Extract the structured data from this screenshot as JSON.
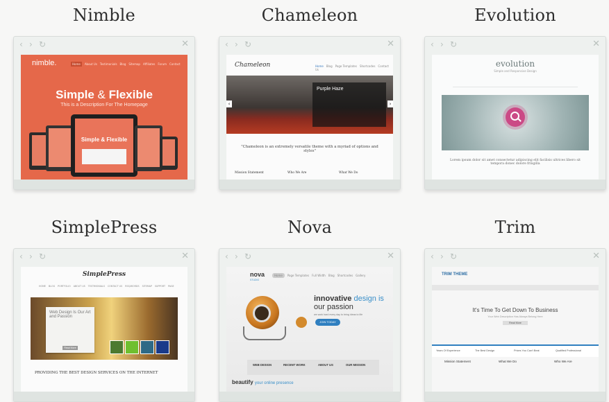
{
  "themes": [
    {
      "title": "Nimble",
      "brand": "nimble.",
      "nav": [
        "Home",
        "About Us",
        "Testimonials",
        "Blog",
        "Sitemap",
        "Affiliates",
        "Forum",
        "Contact"
      ],
      "headline_a": "Simple",
      "headline_amp": "&",
      "headline_b": "Flexible",
      "subline": "This is a Description For The Homepage",
      "inner_headline": "Simple & Flexible",
      "accent": "#e5684a"
    },
    {
      "title": "Chameleon",
      "brand": "Chameleon",
      "nav": [
        "Home",
        "Blog",
        "Page Templates",
        "Shortcodes",
        "Contact Us"
      ],
      "slide_title": "Purple Haze",
      "quote": "\"Chameleon is an extremely versatile theme with a myriad of options and styles\"",
      "columns": [
        "Mission Statement",
        "Who We Are",
        "What We Do"
      ]
    },
    {
      "title": "Evolution",
      "brand": "evolution",
      "tagline": "Simple and Responsive Design",
      "quote": "Lorem ipsum dolor sit amet consectetur adipiscing elit facilisis ultrices libero sit tempora donec dolore fringilla"
    },
    {
      "title": "SimplePress",
      "brand": "SimplePress",
      "nav": [
        "HOME",
        "BLOG",
        "PORTFOLIO",
        "ABOUT US",
        "TESTIMONIALS",
        "CONTACT US",
        "RSS/WORDS",
        "SITEMAP",
        "SUPPORT",
        "PAGE"
      ],
      "card_title": "Web Design Is Our Art and Passion",
      "card_button": "Read More",
      "banner": "PROVIDING THE BEST DESIGN SERVICES ON THE INTERNET"
    },
    {
      "title": "Nova",
      "brand": "nova",
      "brand_sub": "STUDIO",
      "nav": [
        "Home",
        "Page Templates",
        "Full Width",
        "Blog",
        "Shortcodes",
        "Gallery"
      ],
      "headline_a": "innovative",
      "headline_b": "design is",
      "headline_c": "our passion",
      "subline": "we work hard every day to bring ideas to life",
      "cta": "JOIN TODAY",
      "tabs": [
        "WEB DESIGN",
        "RECENT WORK",
        "ABOUT US",
        "OUR MISSION"
      ],
      "tagline_a": "beautify",
      "tagline_b": "your online presence"
    },
    {
      "title": "Trim",
      "brand": "TRIM THEME",
      "headline": "It's Time To Get Down To Business",
      "subline": "Your Web Description Has Always Belong Here",
      "button": "Read More",
      "tabs": [
        "Years Of Experience",
        "The Best Design",
        "Prices You Can't Beat",
        "Qualified Professional"
      ],
      "features": [
        "Mission Statement",
        "What We Do",
        "Who We Are"
      ]
    }
  ],
  "chrome": {
    "back": "‹",
    "forward": "›",
    "reload": "↻",
    "close": "✕"
  }
}
